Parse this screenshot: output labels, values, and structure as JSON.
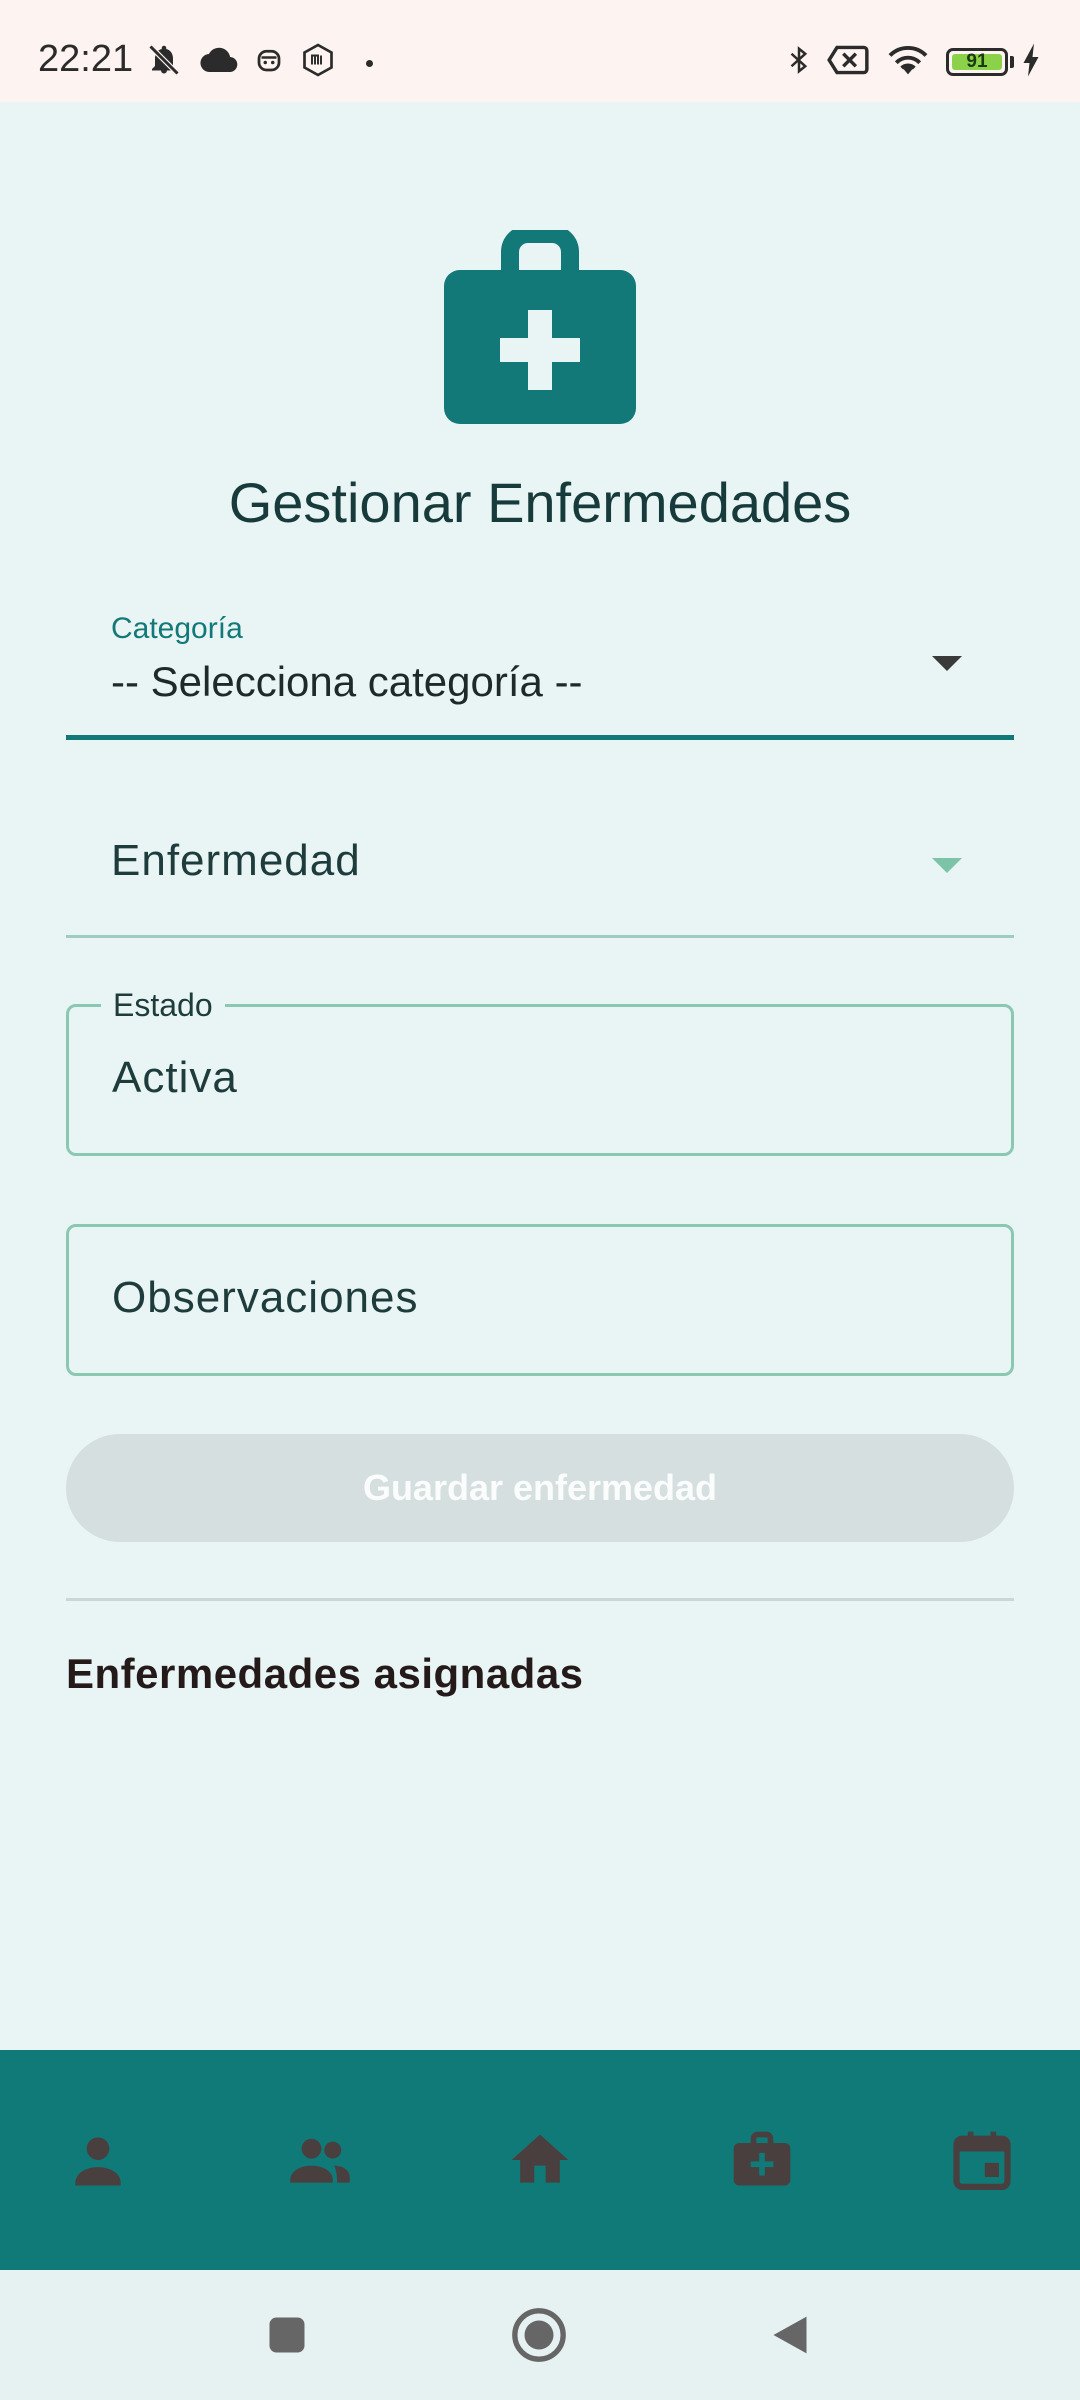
{
  "status_bar": {
    "time": "22:21",
    "battery_percent": "91",
    "icons": [
      "dnd-icon",
      "cloud-icon",
      "robot-icon",
      "mi-icon",
      "bluetooth-icon",
      "no-sim-icon",
      "wifi-icon",
      "battery-icon",
      "charging-icon"
    ]
  },
  "header": {
    "icon": "medical-kit-icon",
    "title": "Gestionar Enfermedades"
  },
  "form": {
    "category": {
      "label": "Categoría",
      "value": "-- Selecciona categoría --"
    },
    "disease": {
      "label": "Enfermedad"
    },
    "status": {
      "label": "Estado",
      "value": "Activa"
    },
    "observations": {
      "placeholder": "Observaciones"
    },
    "save_label": "Guardar enfermedad"
  },
  "assigned": {
    "title": "Enfermedades asignadas"
  },
  "bottom_nav": {
    "items": [
      "person-icon",
      "group-icon",
      "home-icon",
      "medical-kit-icon",
      "calendar-icon"
    ]
  },
  "colors": {
    "primary": "#137878",
    "nav_background": "#0f7a78",
    "page_background": "#e9f4f4",
    "outline": "#8ac8b2",
    "button_disabled": "#d5dfdf"
  }
}
